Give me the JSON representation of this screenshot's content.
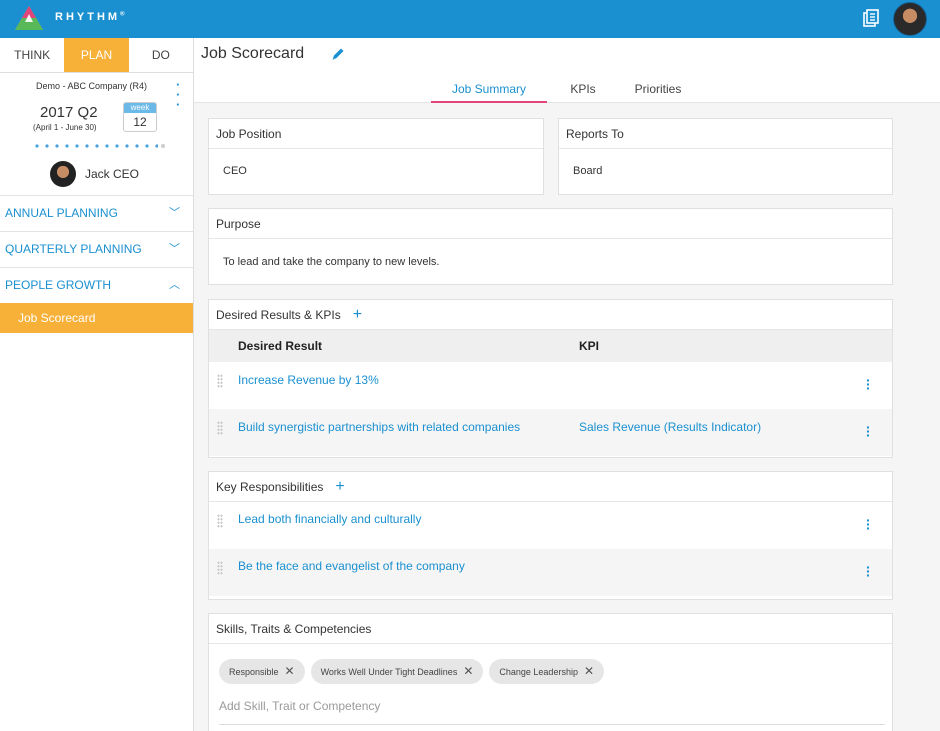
{
  "app": {
    "brand": "RHYTHM",
    "brand_mark": "®"
  },
  "mode_tabs": [
    "THINK",
    "PLAN",
    "DO"
  ],
  "sidebar": {
    "company": "Demo - ABC Company (R4)",
    "quarter": "2017 Q2",
    "quarter_range": "(April 1 - June 30)",
    "week_label": "week",
    "week_number": "12",
    "user_name": "Jack CEO",
    "nav": [
      {
        "label": "ANNUAL PLANNING",
        "chevron": "chevron-down-icon",
        "glyph": "﹀"
      },
      {
        "label": "QUARTERLY PLANNING",
        "chevron": "chevron-down-icon",
        "glyph": "﹀"
      },
      {
        "label": "PEOPLE GROWTH",
        "chevron": "chevron-up-icon",
        "glyph": "︿"
      }
    ],
    "sub_item": "Job Scorecard"
  },
  "main": {
    "title": "Job Scorecard",
    "tabs": [
      "Job Summary",
      "KPIs",
      "Priorities"
    ],
    "job_position": {
      "label": "Job Position",
      "value": "CEO"
    },
    "reports_to": {
      "label": "Reports To",
      "value": "Board"
    },
    "purpose": {
      "label": "Purpose",
      "value": "To lead and take the company to new levels."
    },
    "results": {
      "label": "Desired Results & KPIs",
      "add": "+",
      "col_result": "Desired Result",
      "col_kpi": "KPI",
      "rows": [
        {
          "result": "Increase Revenue by 13%",
          "kpi": ""
        },
        {
          "result": "Build synergistic partnerships with related companies",
          "kpi": "Sales Revenue (Results Indicator)"
        }
      ]
    },
    "responsibilities": {
      "label": "Key Responsibilities",
      "add": "+",
      "rows": [
        "Lead both financially and culturally",
        "Be the face and evangelist of the company"
      ]
    },
    "skills": {
      "label": "Skills, Traits & Competencies",
      "chips": [
        "Responsible",
        "Works Well Under Tight Deadlines",
        "Change Leadership"
      ],
      "placeholder": "Add Skill, Trait or Competency"
    }
  },
  "colors": {
    "header": "#1a90d0",
    "accent": "#f7b139",
    "link": "#1a90d0",
    "tab_underline": "#e0447b"
  }
}
